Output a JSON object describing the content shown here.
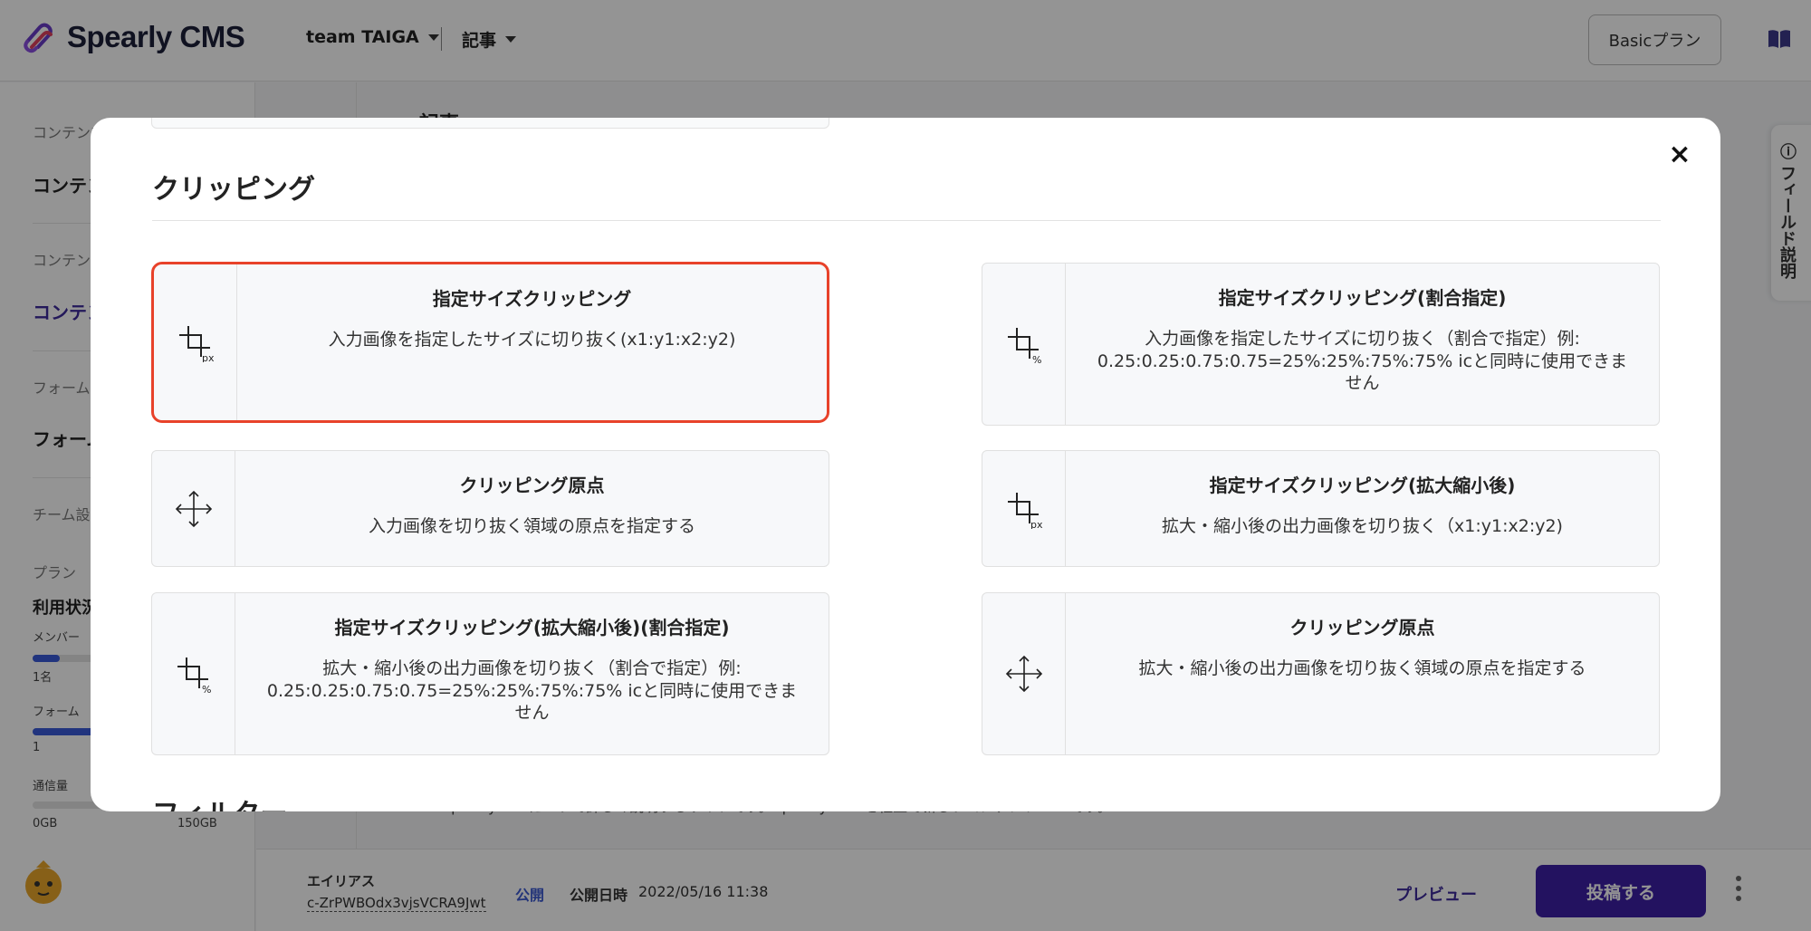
{
  "header": {
    "app_name": "Spearly CMS",
    "team": "team TAIGA",
    "section": "記事",
    "plan_button": "Basicプラン"
  },
  "sidebar": {
    "sec1": "コンテンツ",
    "item1": "コンテンツ",
    "sec2": "コンテンツ",
    "item2": "コンテンツ",
    "sec3": "フォーム",
    "item3": "フォーム",
    "sec4": "チーム設定",
    "plan_label": "プラン",
    "usage_label": "利用状況",
    "member_label": "メンバー",
    "member_count": "1名",
    "member_ratio": 0.16,
    "form_label": "フォーム",
    "form_count": "1",
    "form_ratio": 0.4,
    "traffic_label": "通信量",
    "traffic_min": "0GB",
    "traffic_max": "150GB",
    "traffic_ratio": 0.0
  },
  "content": {
    "heading_peek": "記事",
    "body_peek": "SpearlyCMSについて詳しく説明するサイトです。Spearly CMSを社上で新しいコンテンツCMSです。"
  },
  "field_tab": "フィールド説明",
  "bottom_bar": {
    "alias_label": "エイリアス",
    "alias_value": "c-ZrPWBOdx3vjsVCRA9Jwt",
    "status": "公開",
    "published_label": "公開日時",
    "published_value": "2022/05/16 11:38",
    "preview": "プレビュー",
    "post": "投稿する"
  },
  "modal": {
    "close": "×",
    "section_title": "クリッピング",
    "next_section_title": "フィルター",
    "cards": [
      {
        "icon": "crop-px-icon",
        "title": "指定サイズクリッピング",
        "desc": "入力画像を指定したサイズに切り抜く(x1:y1:x2:y2)",
        "selected": true
      },
      {
        "icon": "crop-percent-icon",
        "title": "指定サイズクリッピング(割合指定)",
        "desc": "入力画像を指定したサイズに切り抜く（割合で指定）例: 0.25:0.25:0.75:0.75=25%:25%:75%:75% icと同時に使用できません"
      },
      {
        "icon": "move-origin-icon",
        "title": "クリッピング原点",
        "desc": "入力画像を切り抜く領域の原点を指定する"
      },
      {
        "icon": "crop-px-icon",
        "title": "指定サイズクリッピング(拡大縮小後)",
        "desc": "拡大・縮小後の出力画像を切り抜く（x1:y1:x2:y2)"
      },
      {
        "icon": "crop-percent-icon",
        "title": "指定サイズクリッピング(拡大縮小後)(割合指定)",
        "desc": "拡大・縮小後の出力画像を切り抜く（割合で指定）例: 0.25:0.25:0.75:0.75=25%:25%:75%:75% icと同時に使用できません"
      },
      {
        "icon": "move-origin-icon",
        "title": "クリッピング原点",
        "desc": "拡大・縮小後の出力画像を切り抜く領域の原点を指定する"
      }
    ]
  }
}
